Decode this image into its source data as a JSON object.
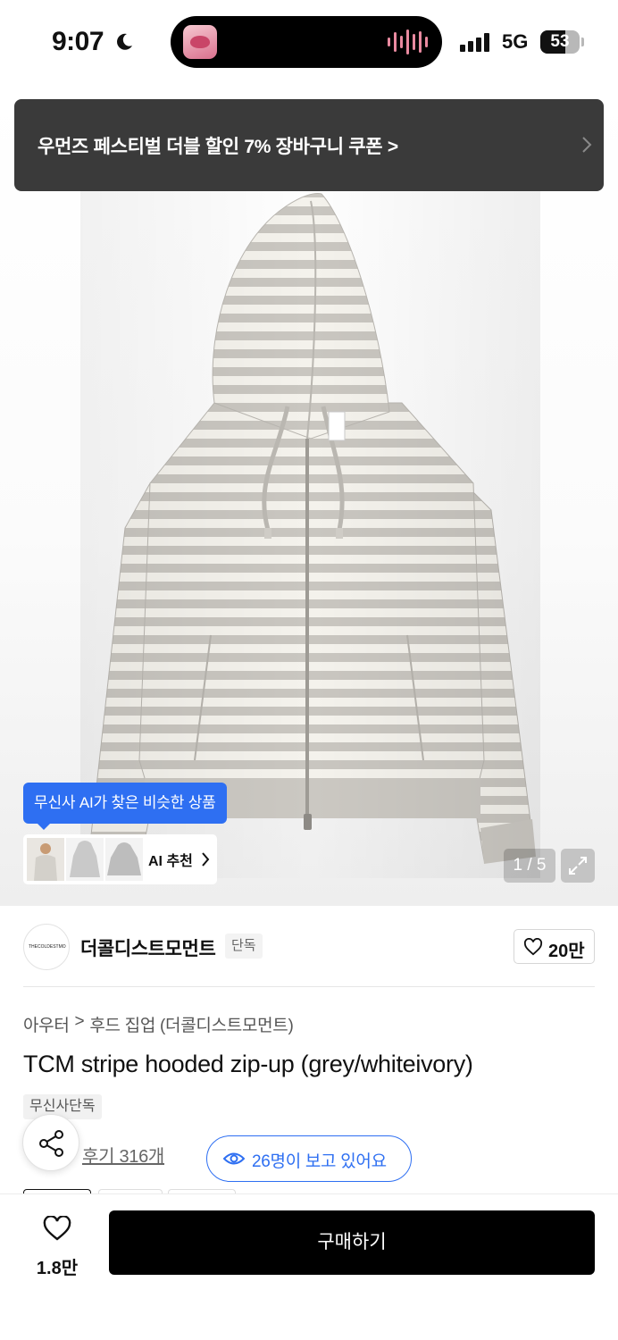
{
  "status_bar": {
    "time": "9:07",
    "network": "5G",
    "battery": "53"
  },
  "banner": {
    "text": "우먼즈 페스티벌 더블 할인 7% 장바구니 쿠폰 >"
  },
  "gallery": {
    "ai_tooltip": "무신사 AI가 찾은 비슷한 상품",
    "ai_label": "AI 추천",
    "page_counter": "1 / 5"
  },
  "brand": {
    "name": "더콜디스트모먼트",
    "badge": "단독",
    "likes": "20만",
    "logo_text": "THECOLDESTMOMENT"
  },
  "product": {
    "breadcrumb": [
      "아우터",
      ">",
      "후드 집업 (더콜디스트모먼트)"
    ],
    "title": "TCM stripe hooded zip-up (grey/whiteivory)",
    "exclusive_badge": "무신사단독",
    "review_link": "후기 316개",
    "viewers": "26명이 보고 있어요"
  },
  "bottom_bar": {
    "wish_count": "1.8만",
    "buy_label": "구매하기"
  },
  "colors": {
    "accent_blue": "#2e6ff2",
    "banner_bg": "#3a3a3a",
    "buy_button_bg": "#000000",
    "stripe_grey": "#c9c6c0",
    "stripe_ivory": "#f4f2ec"
  }
}
